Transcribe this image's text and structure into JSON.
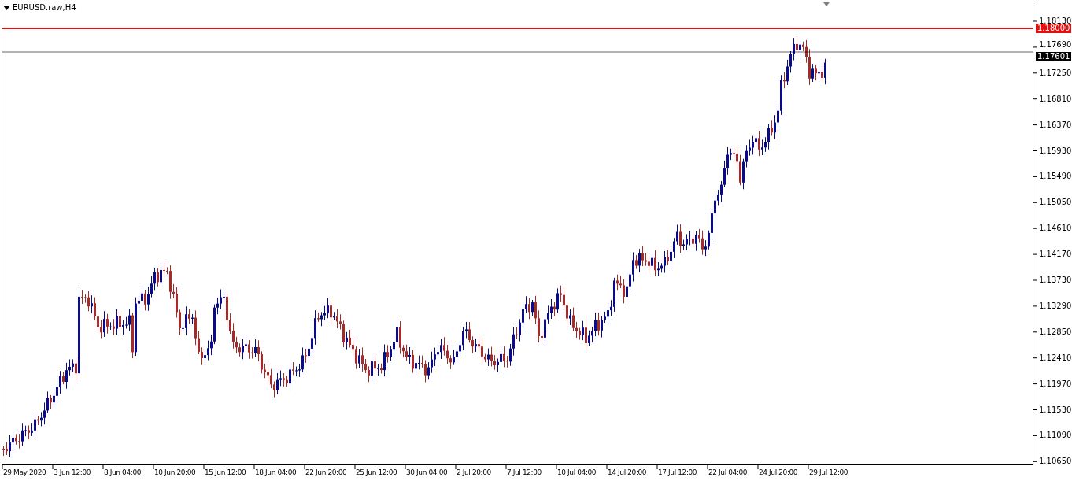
{
  "chart": {
    "symbol": "EURUSD.raw,H4"
  },
  "price_axis": {
    "labels": [
      "1.18130",
      "1.17690",
      "1.17250",
      "1.16810",
      "1.16370",
      "1.15930",
      "1.15490",
      "1.15050",
      "1.14610",
      "1.14170",
      "1.13730",
      "1.13290",
      "1.12850",
      "1.12410",
      "1.11970",
      "1.11530",
      "1.11090",
      "1.10650"
    ]
  },
  "time_axis": {
    "labels": [
      "29 May 2020",
      "3 Jun 12:00",
      "8 Jun 04:00",
      "10 Jun 20:00",
      "15 Jun 12:00",
      "18 Jun 04:00",
      "22 Jun 20:00",
      "25 Jun 12:00",
      "30 Jun 04:00",
      "2 Jul 20:00",
      "7 Jul 12:00",
      "10 Jul 04:00",
      "14 Jul 20:00",
      "17 Jul 12:00",
      "22 Jul 04:00",
      "24 Jul 20:00",
      "29 Jul 12:00"
    ]
  },
  "price_lines": [
    {
      "label": "1.18000",
      "color": "#e01010"
    },
    {
      "label": "1.17601",
      "color": "#000000"
    }
  ]
}
